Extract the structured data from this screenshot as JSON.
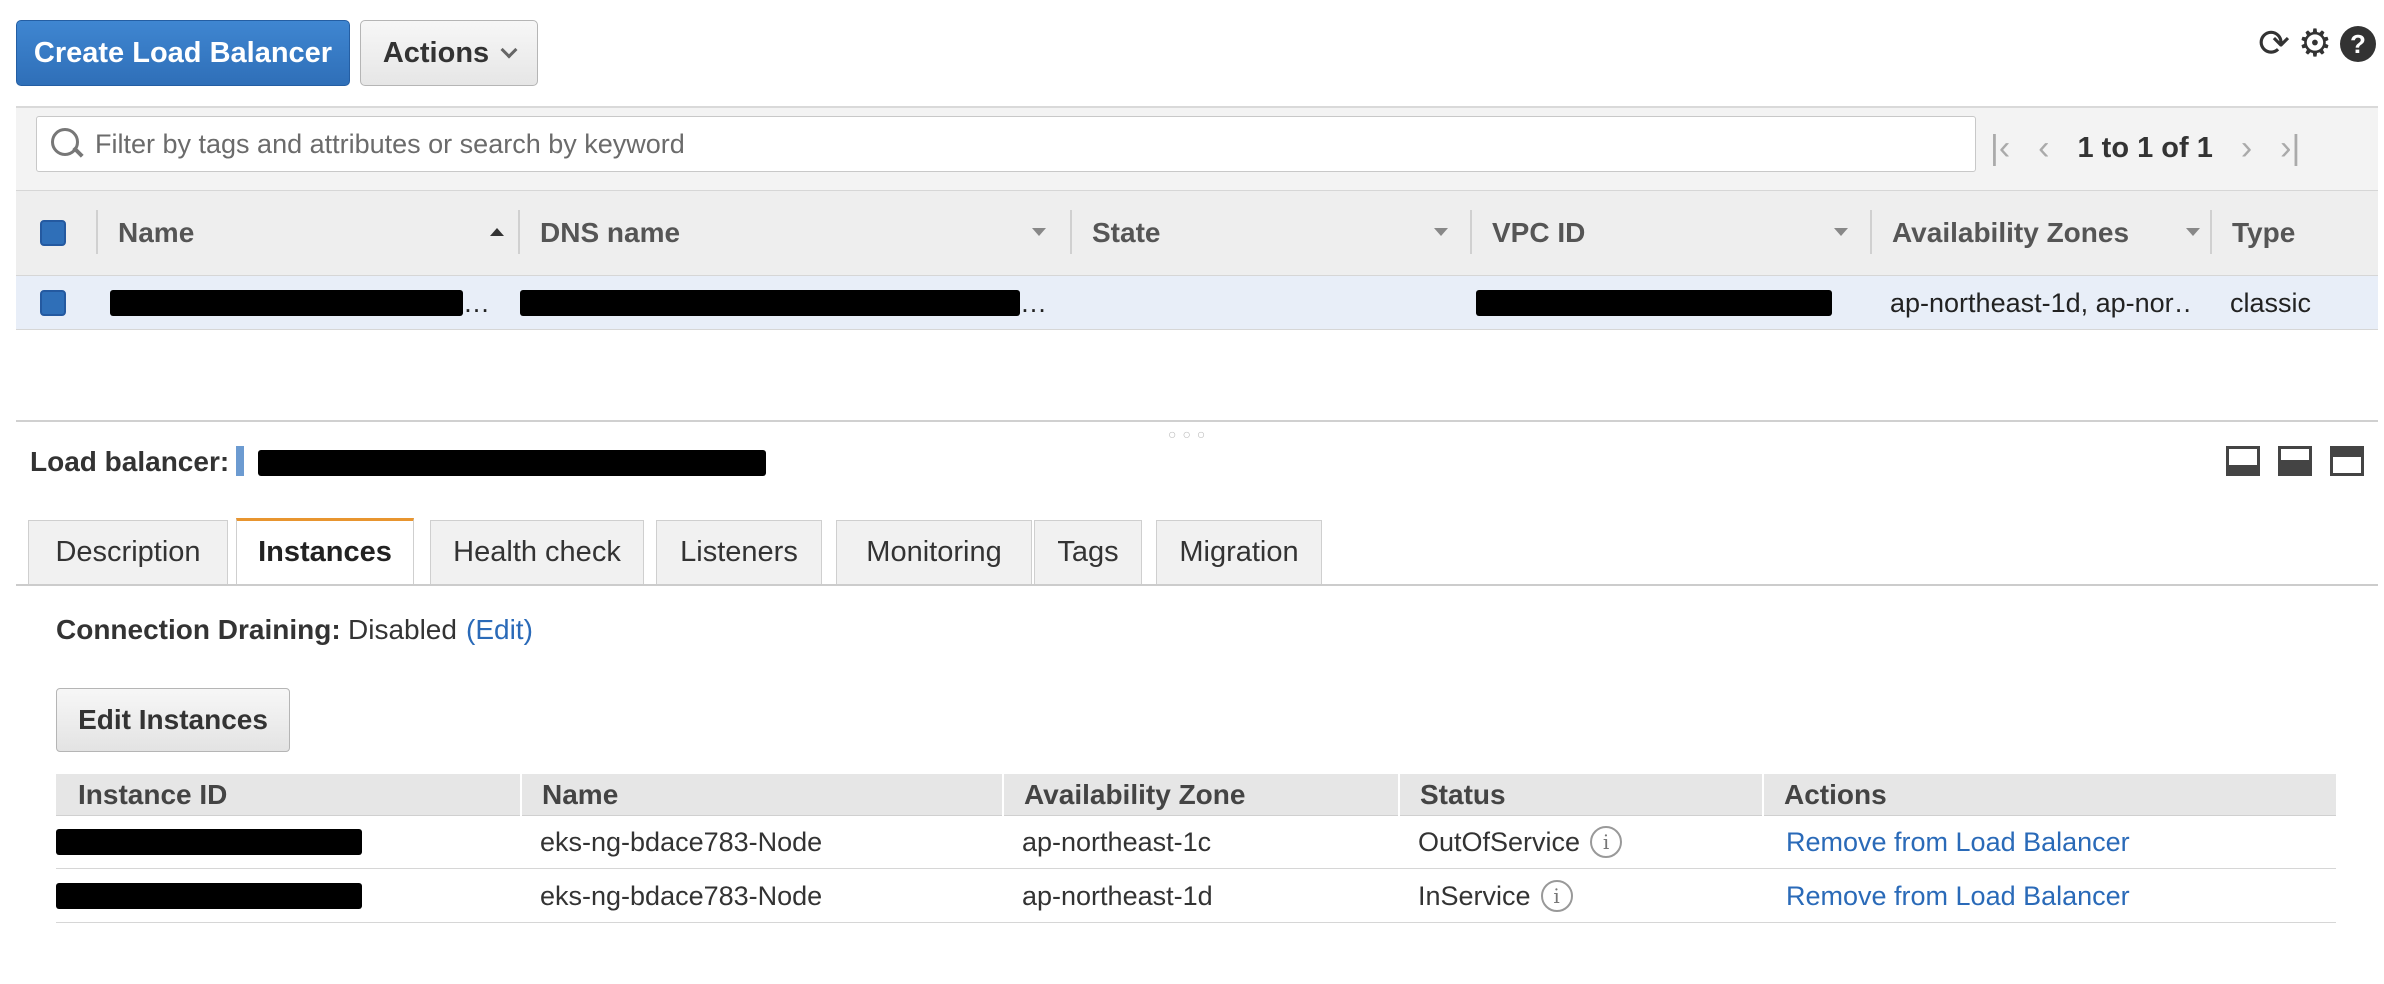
{
  "toolbar": {
    "create_label": "Create Load Balancer",
    "actions_label": "Actions",
    "icons": [
      "refresh-icon",
      "gear-icon",
      "help-icon"
    ]
  },
  "filter": {
    "placeholder": "Filter by tags and attributes or search by keyword",
    "pagination": "1 to 1 of 1"
  },
  "main_table": {
    "columns": [
      "Name",
      "DNS name",
      "State",
      "VPC ID",
      "Availability Zones",
      "Type"
    ],
    "rows": [
      {
        "name": "[redacted]",
        "dns_name": "[redacted]",
        "state": "",
        "vpc_id": "[redacted]",
        "availability_zones": "ap-northeast-1d, ap-nor…",
        "type": "classic"
      }
    ]
  },
  "detail": {
    "label": "Load balancer:",
    "name": "[redacted]"
  },
  "tabs": [
    "Description",
    "Instances",
    "Health check",
    "Listeners",
    "Monitoring",
    "Tags",
    "Migration"
  ],
  "active_tab": "Instances",
  "connection_draining": {
    "label": "Connection Draining:",
    "value": "Disabled",
    "edit_label": "(Edit)"
  },
  "edit_instances_label": "Edit Instances",
  "instances_table": {
    "columns": [
      "Instance ID",
      "Name",
      "Availability Zone",
      "Status",
      "Actions"
    ],
    "rows": [
      {
        "instance_id": "[redacted]",
        "name": "eks-ng-bdace783-Node",
        "zone": "ap-northeast-1c",
        "status": "OutOfService",
        "action": "Remove from Load Balancer"
      },
      {
        "instance_id": "[redacted]",
        "name": "eks-ng-bdace783-Node",
        "zone": "ap-northeast-1d",
        "status": "InService",
        "action": "Remove from Load Balancer"
      }
    ]
  },
  "colors": {
    "primary": "#2f6fb8",
    "link": "#2a6ab8",
    "tab_accent": "#e8952f",
    "selected_row": "#e8eef8"
  }
}
